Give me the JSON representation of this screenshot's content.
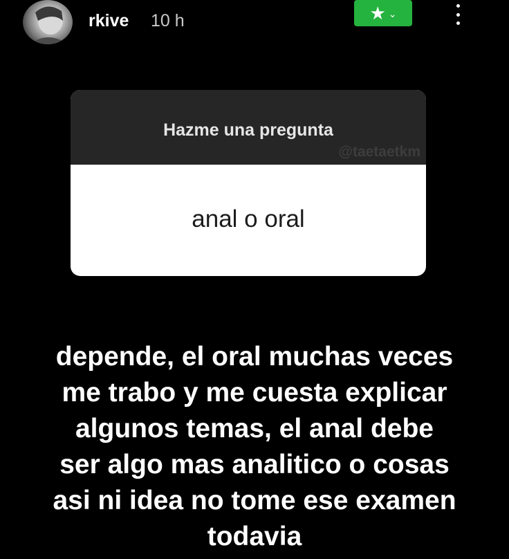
{
  "header": {
    "username": "rkive",
    "time": "10 h",
    "close_friends_icon": "star-icon",
    "close_friends_color": "#25b33f",
    "menu_icon": "more-vertical-icon"
  },
  "question_sticker": {
    "title": "Hazme una pregunta",
    "watermark": "@taetaetkm",
    "question": "anal o oral"
  },
  "reply": {
    "lines": [
      "depende, el oral muchas veces",
      "me trabo y me cuesta explicar",
      "algunos temas, el anal debe",
      "ser algo mas analitico o cosas",
      "asi ni idea no tome ese examen",
      "todavia"
    ]
  }
}
